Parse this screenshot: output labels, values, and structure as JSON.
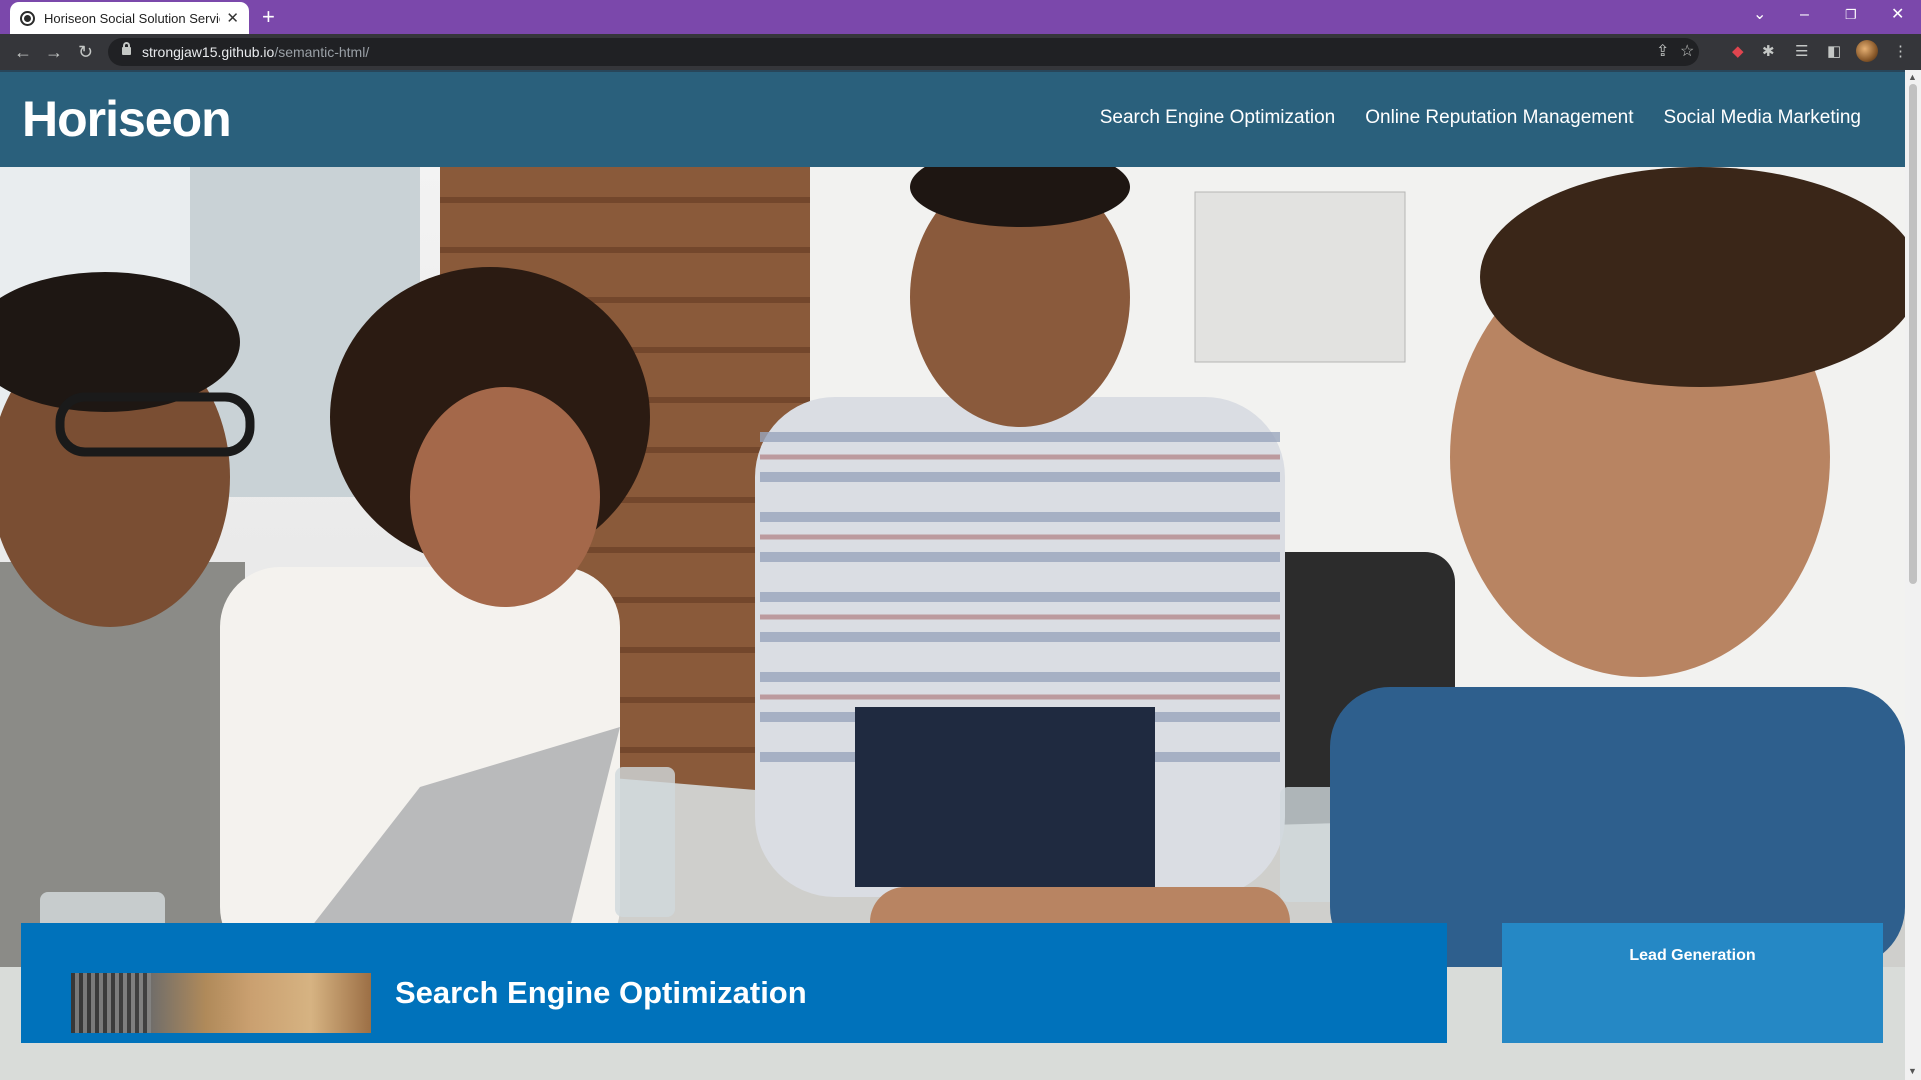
{
  "browser": {
    "tab_title": "Horiseon Social Solution Services",
    "tab_close": "✕",
    "new_tab": "+",
    "url_host": "strongjaw15.github.io",
    "url_path": "/semantic-html/",
    "icons": [
      "back-arrow-icon",
      "forward-arrow-icon",
      "reload-icon",
      "lock-icon",
      "share-icon",
      "bookmark-star-icon",
      "extension-puzzle-icon",
      "reading-list-icon",
      "side-panel-icon",
      "menu-dots-icon"
    ]
  },
  "header": {
    "logo": "Horiseon",
    "nav": [
      "Search Engine Optimization",
      "Online Reputation Management",
      "Social Media Marketing"
    ]
  },
  "main": {
    "section_title": "Search Engine Optimization"
  },
  "aside": {
    "title": "Lead Generation"
  },
  "colors": {
    "tabstrip": "#7b48ab",
    "header": "#2a607c",
    "content": "#0072bb",
    "aside": "#2588c5",
    "page_bg": "#d9dcd9"
  }
}
